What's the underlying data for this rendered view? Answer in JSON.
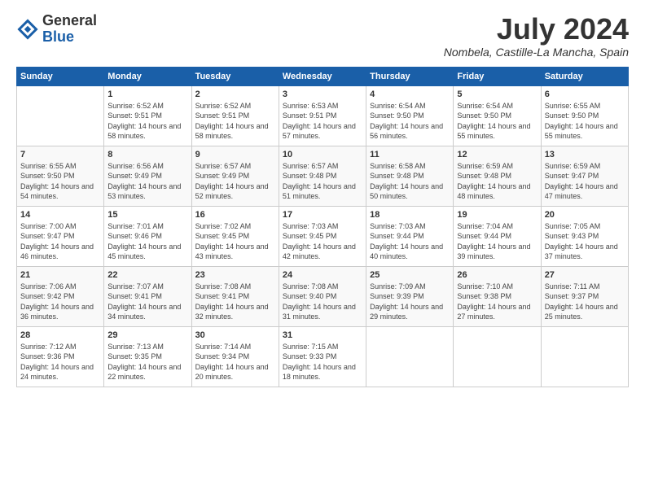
{
  "header": {
    "logo_general": "General",
    "logo_blue": "Blue",
    "month_year": "July 2024",
    "location": "Nombela, Castille-La Mancha, Spain"
  },
  "calendar": {
    "days_of_week": [
      "Sunday",
      "Monday",
      "Tuesday",
      "Wednesday",
      "Thursday",
      "Friday",
      "Saturday"
    ],
    "weeks": [
      [
        {
          "day": "",
          "info": ""
        },
        {
          "day": "1",
          "info": "Sunrise: 6:52 AM\nSunset: 9:51 PM\nDaylight: 14 hours and 58 minutes."
        },
        {
          "day": "2",
          "info": "Sunrise: 6:52 AM\nSunset: 9:51 PM\nDaylight: 14 hours and 58 minutes."
        },
        {
          "day": "3",
          "info": "Sunrise: 6:53 AM\nSunset: 9:51 PM\nDaylight: 14 hours and 57 minutes."
        },
        {
          "day": "4",
          "info": "Sunrise: 6:54 AM\nSunset: 9:50 PM\nDaylight: 14 hours and 56 minutes."
        },
        {
          "day": "5",
          "info": "Sunrise: 6:54 AM\nSunset: 9:50 PM\nDaylight: 14 hours and 55 minutes."
        },
        {
          "day": "6",
          "info": "Sunrise: 6:55 AM\nSunset: 9:50 PM\nDaylight: 14 hours and 55 minutes."
        }
      ],
      [
        {
          "day": "7",
          "info": "Sunrise: 6:55 AM\nSunset: 9:50 PM\nDaylight: 14 hours and 54 minutes."
        },
        {
          "day": "8",
          "info": "Sunrise: 6:56 AM\nSunset: 9:49 PM\nDaylight: 14 hours and 53 minutes."
        },
        {
          "day": "9",
          "info": "Sunrise: 6:57 AM\nSunset: 9:49 PM\nDaylight: 14 hours and 52 minutes."
        },
        {
          "day": "10",
          "info": "Sunrise: 6:57 AM\nSunset: 9:48 PM\nDaylight: 14 hours and 51 minutes."
        },
        {
          "day": "11",
          "info": "Sunrise: 6:58 AM\nSunset: 9:48 PM\nDaylight: 14 hours and 50 minutes."
        },
        {
          "day": "12",
          "info": "Sunrise: 6:59 AM\nSunset: 9:48 PM\nDaylight: 14 hours and 48 minutes."
        },
        {
          "day": "13",
          "info": "Sunrise: 6:59 AM\nSunset: 9:47 PM\nDaylight: 14 hours and 47 minutes."
        }
      ],
      [
        {
          "day": "14",
          "info": "Sunrise: 7:00 AM\nSunset: 9:47 PM\nDaylight: 14 hours and 46 minutes."
        },
        {
          "day": "15",
          "info": "Sunrise: 7:01 AM\nSunset: 9:46 PM\nDaylight: 14 hours and 45 minutes."
        },
        {
          "day": "16",
          "info": "Sunrise: 7:02 AM\nSunset: 9:45 PM\nDaylight: 14 hours and 43 minutes."
        },
        {
          "day": "17",
          "info": "Sunrise: 7:03 AM\nSunset: 9:45 PM\nDaylight: 14 hours and 42 minutes."
        },
        {
          "day": "18",
          "info": "Sunrise: 7:03 AM\nSunset: 9:44 PM\nDaylight: 14 hours and 40 minutes."
        },
        {
          "day": "19",
          "info": "Sunrise: 7:04 AM\nSunset: 9:44 PM\nDaylight: 14 hours and 39 minutes."
        },
        {
          "day": "20",
          "info": "Sunrise: 7:05 AM\nSunset: 9:43 PM\nDaylight: 14 hours and 37 minutes."
        }
      ],
      [
        {
          "day": "21",
          "info": "Sunrise: 7:06 AM\nSunset: 9:42 PM\nDaylight: 14 hours and 36 minutes."
        },
        {
          "day": "22",
          "info": "Sunrise: 7:07 AM\nSunset: 9:41 PM\nDaylight: 14 hours and 34 minutes."
        },
        {
          "day": "23",
          "info": "Sunrise: 7:08 AM\nSunset: 9:41 PM\nDaylight: 14 hours and 32 minutes."
        },
        {
          "day": "24",
          "info": "Sunrise: 7:08 AM\nSunset: 9:40 PM\nDaylight: 14 hours and 31 minutes."
        },
        {
          "day": "25",
          "info": "Sunrise: 7:09 AM\nSunset: 9:39 PM\nDaylight: 14 hours and 29 minutes."
        },
        {
          "day": "26",
          "info": "Sunrise: 7:10 AM\nSunset: 9:38 PM\nDaylight: 14 hours and 27 minutes."
        },
        {
          "day": "27",
          "info": "Sunrise: 7:11 AM\nSunset: 9:37 PM\nDaylight: 14 hours and 25 minutes."
        }
      ],
      [
        {
          "day": "28",
          "info": "Sunrise: 7:12 AM\nSunset: 9:36 PM\nDaylight: 14 hours and 24 minutes."
        },
        {
          "day": "29",
          "info": "Sunrise: 7:13 AM\nSunset: 9:35 PM\nDaylight: 14 hours and 22 minutes."
        },
        {
          "day": "30",
          "info": "Sunrise: 7:14 AM\nSunset: 9:34 PM\nDaylight: 14 hours and 20 minutes."
        },
        {
          "day": "31",
          "info": "Sunrise: 7:15 AM\nSunset: 9:33 PM\nDaylight: 14 hours and 18 minutes."
        },
        {
          "day": "",
          "info": ""
        },
        {
          "day": "",
          "info": ""
        },
        {
          "day": "",
          "info": ""
        }
      ]
    ]
  }
}
